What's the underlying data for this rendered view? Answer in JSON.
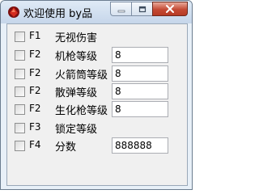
{
  "window": {
    "title": "欢迎使用 by品"
  },
  "icons": {
    "app": "red-gem-icon",
    "minimize": "minimize-icon",
    "maximize": "maximize-icon",
    "close": "close-icon"
  },
  "colors": {
    "close_button": "#c44a34",
    "titlebar": "#c6d6ea",
    "client_background": "#f0f0f0"
  },
  "rows": [
    {
      "hotkey": "F1",
      "label": "无视伤害",
      "checked": false
    },
    {
      "hotkey": "F2",
      "label": "机枪等级",
      "checked": false,
      "value": "8"
    },
    {
      "hotkey": "F2",
      "label": "火箭筒等级",
      "checked": false,
      "value": "8"
    },
    {
      "hotkey": "F2",
      "label": "散弹等级",
      "checked": false,
      "value": "8"
    },
    {
      "hotkey": "F2",
      "label": "生化枪等级",
      "checked": false,
      "value": "8"
    },
    {
      "hotkey": "F3",
      "label": "锁定等级",
      "checked": false
    },
    {
      "hotkey": "F4",
      "label": "分数",
      "checked": false,
      "value": "888888"
    }
  ]
}
